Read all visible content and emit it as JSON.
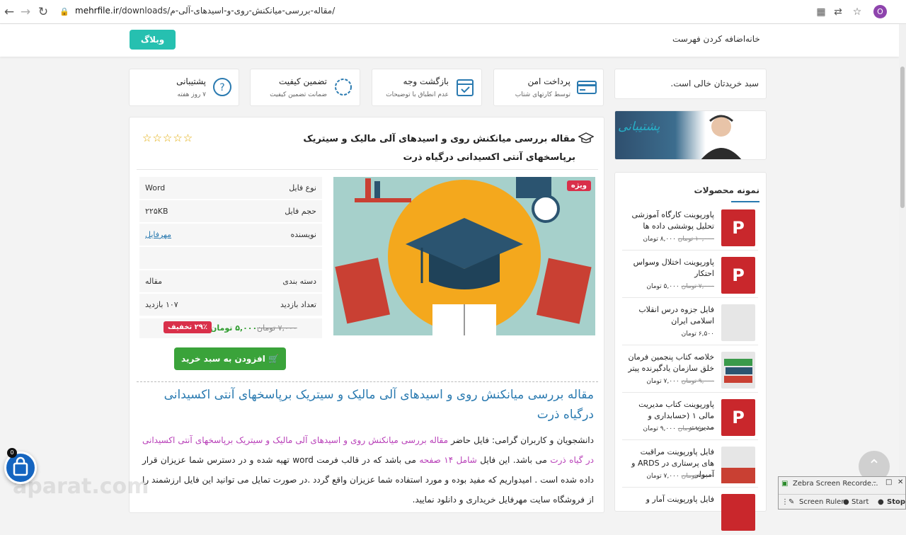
{
  "browser": {
    "url_domain": "mehrfile.ir",
    "url_path": "/downloads/مقاله-بررسی-میانکنش-روی-و-اسیدهای-آلی-م/",
    "avatar_letter": "O"
  },
  "header": {
    "weblog_label": "وبلاگ",
    "menu": [
      "خانه",
      "اضافه کردن فهرست"
    ]
  },
  "features": [
    {
      "title": "پرداخت امن",
      "subtitle": "توسط کارتهای شتاب",
      "icon": "credit-card-icon"
    },
    {
      "title": "بازگشت وجه",
      "subtitle": "عدم انطباق با توضیحات",
      "icon": "calendar-check-icon"
    },
    {
      "title": "تضمین کیفیت",
      "subtitle": "ضمانت تضمین کیفیت",
      "icon": "quality-badge-icon"
    },
    {
      "title": "پشتیبانی",
      "subtitle": "۷ روز هفته",
      "icon": "question-icon"
    }
  ],
  "product": {
    "title": "مقاله بررسی میانکنش روی و اسیدهای آلی مالیک و سیتریک برپاسخهای آنتی اکسیدانی درگیاه ذرت",
    "stars": "☆☆☆☆☆",
    "vip_badge": "ویژه",
    "info": [
      {
        "label": "نوع فایل",
        "value": "Word"
      },
      {
        "label": "حجم فایل",
        "value": "۲۲۵KB"
      },
      {
        "label": "نویسنده",
        "value": "مهرفایل",
        "link": true
      },
      {
        "label": "",
        "value": ""
      },
      {
        "label": "دسته بندی",
        "value": "مقاله"
      },
      {
        "label": "تعداد بازدید",
        "value": "۱۰۷ بازدید"
      }
    ],
    "old_price": "۷,۰۰۰ تومان",
    "new_price": "۵,۰۰۰ تومان",
    "discount": "۲۹٪ تخفیف",
    "add_to_cart": "افزودن به سبد خرید"
  },
  "article": {
    "heading": "مقاله بررسی میانکنش روی و اسیدهای آلی مالیک و سیتریک برپاسخهای آنتی اکسیدانی درگیاه ذرت",
    "body_start": "دانشجویان و کاربران گرامی: فایل حاضر",
    "body_pink1": "مقاله بررسی میانکنش روی و اسیدهای آلی مالیک و سیتریک برپاسخهای آنتی اکسیدانی در گیاه ذرت",
    "body_mid": "می باشد. این فایل",
    "body_pink2": "شامل ۱۴ صفحه",
    "body_end": "می باشد که در قالب فرمت word تهیه شده و در دسترس شما عزیزان قرار داده شده است . امیدواریم که مفید بوده و مورد استفاده شما عزیزان واقع گردد .در صورت تمایل می توانید این فایل ارزشمند را از فروشگاه سایت مهرفایل خریداری و دانلود نمایید."
  },
  "sidebar": {
    "cart_empty": "سبد خریدتان خالی است.",
    "support_text": "پشتیبانی",
    "samples_title": "نمونه محصولات",
    "samples": [
      {
        "title": "پاورپوینت کارگاه آموزشی تحلیل پوششی داده ها",
        "old": "۱۰,۰۰۰ تومان",
        "new": "۸,۰۰۰ تومان",
        "thumb": "ppt"
      },
      {
        "title": "پاورپوینت اختلال وسواس احتکار",
        "old": "۷,۰۰۰ تومان",
        "new": "۵,۰۰۰ تومان",
        "thumb": "ppt"
      },
      {
        "title": "فایل جزوه درس انقلاب اسلامی ایران",
        "old": "",
        "new": "۶,۵۰۰ تومان",
        "thumb": "doc"
      },
      {
        "title": "خلاصه کتاب پنجمین فرمان خلق سازمان یادگیرنده پیتر",
        "old": "۹,۰۰۰ تومان",
        "new": "۷,۰۰۰ تومان",
        "thumb": "book"
      },
      {
        "title": "پاورپوینت کتاب مدیریت مالی ۱ (حسابداری و مدیریت",
        "old": "۱۱,۰۰۰ تومان",
        "new": "۹,۰۰۰ تومان",
        "thumb": "ppt"
      },
      {
        "title": "فایل پاورپوینت مراقبت های پرستاری در ARDS و آمبولی",
        "old": "۹,۰۰۰ تومان",
        "new": "۷,۰۰۰ تومان",
        "thumb": "pptdoc"
      },
      {
        "title": "فایل پاورپوینت آمار و",
        "old": "",
        "new": "",
        "thumb": "ppt"
      }
    ]
  },
  "overlay": {
    "cart_count": "0",
    "watermark": "aparat.com",
    "zebra_title": "Zebra Screen Recorde...",
    "zebra_ruler": "Screen Ruler",
    "zebra_start": "Start",
    "zebra_stop": "Stop"
  }
}
